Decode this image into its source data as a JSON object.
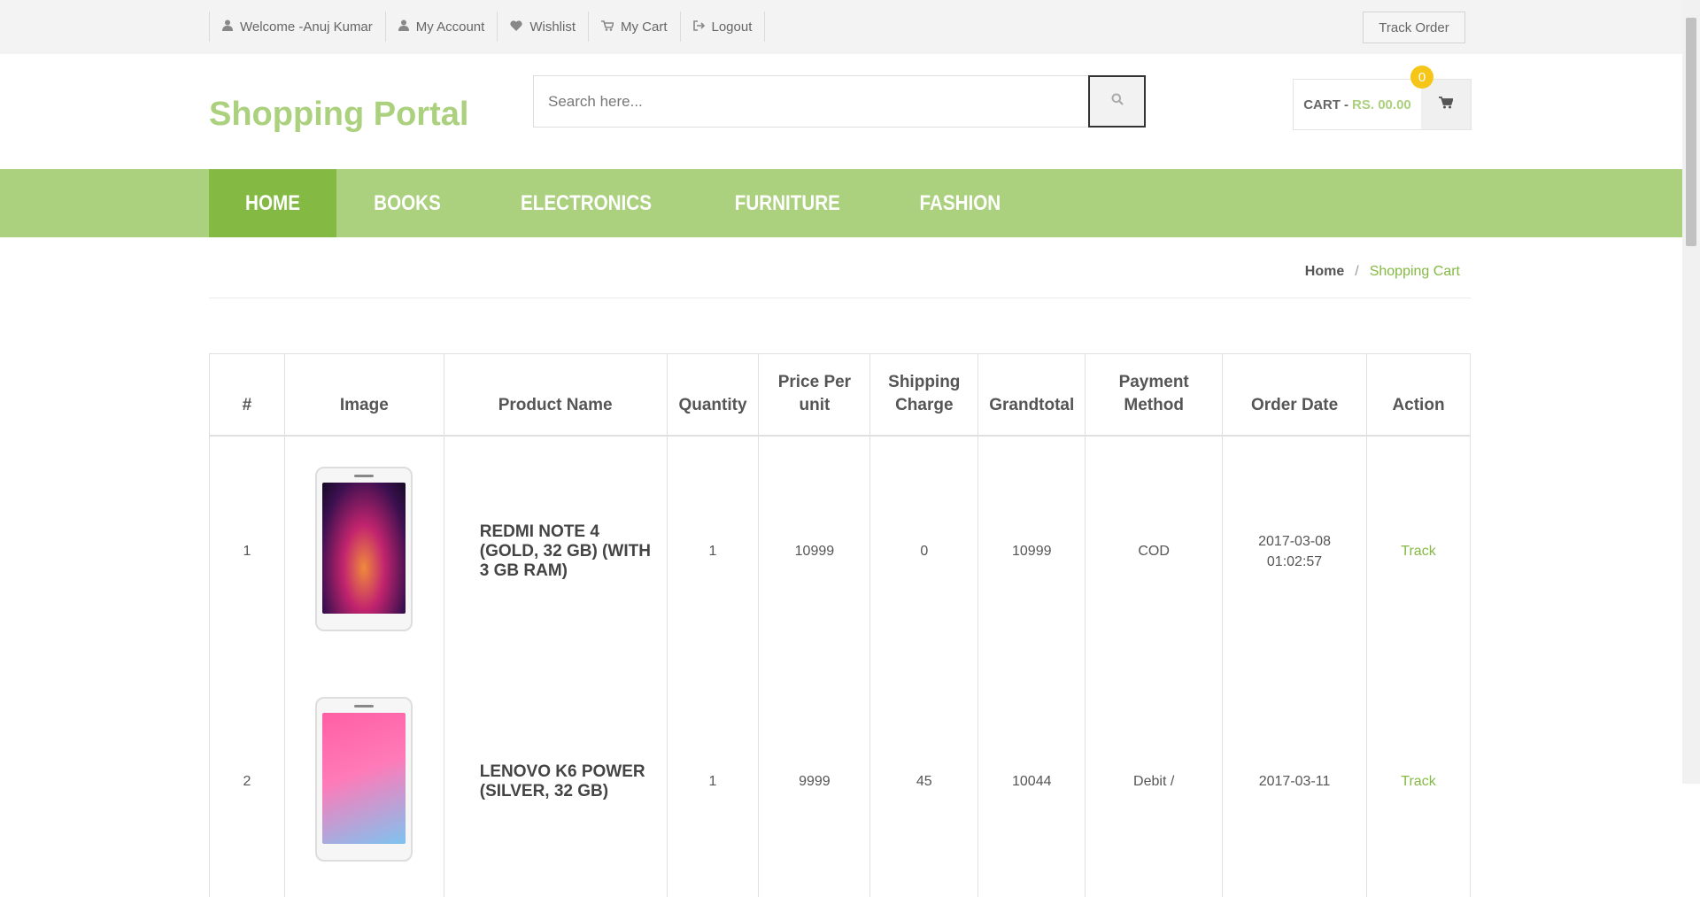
{
  "topbar": {
    "items": [
      {
        "label": "Welcome -Anuj Kumar",
        "icon": "user-icon"
      },
      {
        "label": "My Account",
        "icon": "user-icon"
      },
      {
        "label": "Wishlist",
        "icon": "heart-icon"
      },
      {
        "label": "My Cart",
        "icon": "cart-icon"
      },
      {
        "label": "Logout",
        "icon": "logout-icon"
      }
    ],
    "track_order": "Track Order"
  },
  "header": {
    "logo": "Shopping Portal",
    "search_placeholder": "Search here...",
    "cart_label": "CART -",
    "cart_amount": "RS. 00.00",
    "cart_count": "0"
  },
  "nav": {
    "items": [
      "HOME",
      "BOOKS",
      "ELECTRONICS",
      "FURNITURE",
      "FASHION"
    ]
  },
  "breadcrumb": {
    "home": "Home",
    "separator": "/",
    "current": "Shopping Cart"
  },
  "table": {
    "headers": [
      "#",
      "Image",
      "Product Name",
      "Quantity",
      "Price Per unit",
      "Shipping Charge",
      "Grandtotal",
      "Payment Method",
      "Order Date",
      "Action"
    ],
    "rows": [
      {
        "num": "1",
        "product": "REDMI NOTE 4 (GOLD, 32 GB) (WITH 3 GB RAM)",
        "qty": "1",
        "price": "10999",
        "shipping": "0",
        "total": "10999",
        "payment": "COD",
        "date": "2017-03-08 01:02:57",
        "action": "Track"
      },
      {
        "num": "2",
        "product": "LENOVO K6 POWER (SILVER, 32 GB)",
        "qty": "1",
        "price": "9999",
        "shipping": "45",
        "total": "10044",
        "payment": "Debit /",
        "date": "2017-03-11",
        "action": "Track"
      }
    ]
  },
  "colors": {
    "accent": "#abd07e",
    "accent_dark": "#84b943",
    "badge": "#f5c518"
  }
}
